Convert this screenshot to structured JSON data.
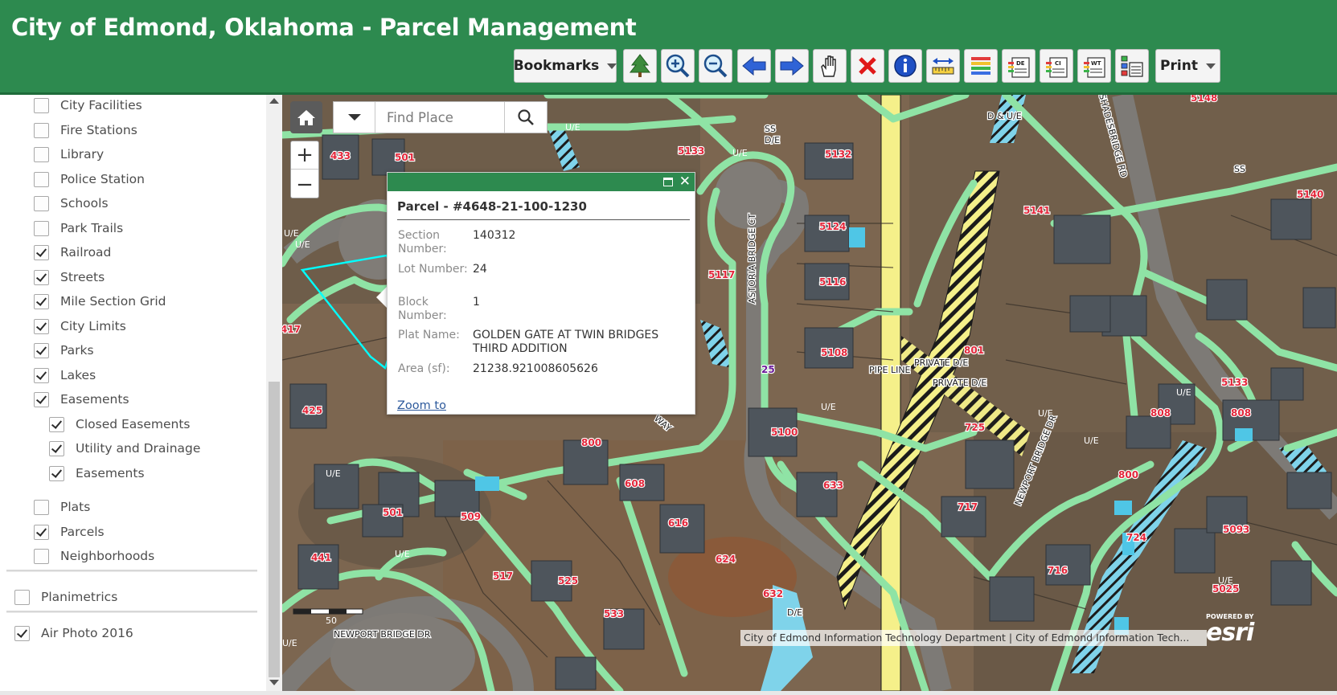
{
  "app": {
    "title": "City of Edmond, Oklahoma - Parcel Management"
  },
  "toolbar": {
    "bookmarks_label": "Bookmarks",
    "print_label": "Print",
    "tool_icons": [
      "tree-icon",
      "zoom-in-icon",
      "zoom-out-icon",
      "back-arrow-icon",
      "forward-arrow-icon",
      "pan-hand-icon",
      "clear-x-icon",
      "identify-info-icon",
      "measure-icon",
      "legend-icon",
      "de-layer-icon",
      "ci-layer-icon",
      "wt-layer-icon",
      "layer-list-icon"
    ],
    "icon_badges": {
      "de": "DE",
      "ci": "CI",
      "wt": "WT"
    }
  },
  "sidebar": {
    "layers": [
      {
        "label": "City Facilities",
        "checked": false
      },
      {
        "label": "Fire Stations",
        "checked": false
      },
      {
        "label": "Library",
        "checked": false
      },
      {
        "label": "Police Station",
        "checked": false
      },
      {
        "label": "Schools",
        "checked": false
      },
      {
        "label": "Park Trails",
        "checked": false
      },
      {
        "label": "Railroad",
        "checked": true
      },
      {
        "label": "Streets",
        "checked": true
      },
      {
        "label": "Mile Section Grid",
        "checked": true
      },
      {
        "label": "City Limits",
        "checked": true
      },
      {
        "label": "Parks",
        "checked": true
      },
      {
        "label": "Lakes",
        "checked": true
      },
      {
        "label": "Easements",
        "checked": true
      }
    ],
    "sublayers": [
      {
        "label": "Closed Easements",
        "checked": true
      },
      {
        "label": "Utility and Drainage",
        "checked": true
      },
      {
        "label": "Easements",
        "checked": true
      }
    ],
    "lower_layers": [
      {
        "label": "Plats",
        "checked": false
      },
      {
        "label": "Parcels",
        "checked": true
      },
      {
        "label": "Neighborhoods",
        "checked": false
      }
    ],
    "groups": [
      {
        "label": "Planimetrics",
        "checked": false
      },
      {
        "label": "Air Photo 2016",
        "checked": true
      }
    ]
  },
  "map": {
    "search_placeholder": "Find Place",
    "zoom_in": "+",
    "zoom_out": "−",
    "attribution": "City of Edmond Information Technology Department | City of Edmond Information Tech...",
    "esri_powered": "POWERED BY",
    "esri_word": "esri",
    "scale_label": "50",
    "street_labels": {
      "astoria": "ASTORIA BRIDGE CT",
      "newport_dr": "NEWPORT BRIDGE DR",
      "newport_dr2": "NEWPORT BRIDGE DR",
      "shadesbridge": "SHADESBRIDGE RD",
      "way": "WAY"
    },
    "easement_labels": {
      "ue": "U/E",
      "de": "D/E",
      "due": "D & U/E",
      "ss": "SS",
      "pipe": "PIPE LINE",
      "private1": "PRIVATE D/E",
      "private2": "PRIVATE D/E"
    },
    "parcel_numbers": [
      "433",
      "501",
      "5133",
      "5132",
      "5148",
      "5140",
      "5141",
      "5124",
      "5117",
      "5116",
      "5108",
      "5100",
      "417",
      "425",
      "800",
      "808",
      "801",
      "725",
      "717",
      "633",
      "616",
      "608",
      "509",
      "501",
      "441",
      "517",
      "525",
      "533",
      "624",
      "632",
      "716",
      "724",
      "5093",
      "5025",
      "808",
      "800",
      "5133",
      "25"
    ]
  },
  "popup": {
    "title": "Parcel - #4648-21-100-1230",
    "fields": [
      {
        "label": "Section Number:",
        "value": "140312"
      },
      {
        "label": "Lot Number:",
        "value": "24"
      },
      {
        "label": "Block Number:",
        "value": "1"
      },
      {
        "label": "Plat Name:",
        "value": "GOLDEN GATE AT TWIN BRIDGES THIRD ADDITION"
      },
      {
        "label": "Area (sf):",
        "value": "21238.921008605626"
      }
    ],
    "zoom_link": "Zoom to"
  },
  "colors": {
    "header_green": "#2d8a4f",
    "easement_green": "#8fe3a5",
    "pipeline_yellow": "#f5f08a",
    "drainage_blue": "#7fd3ea",
    "parcel_label_red": "#e3263a"
  }
}
